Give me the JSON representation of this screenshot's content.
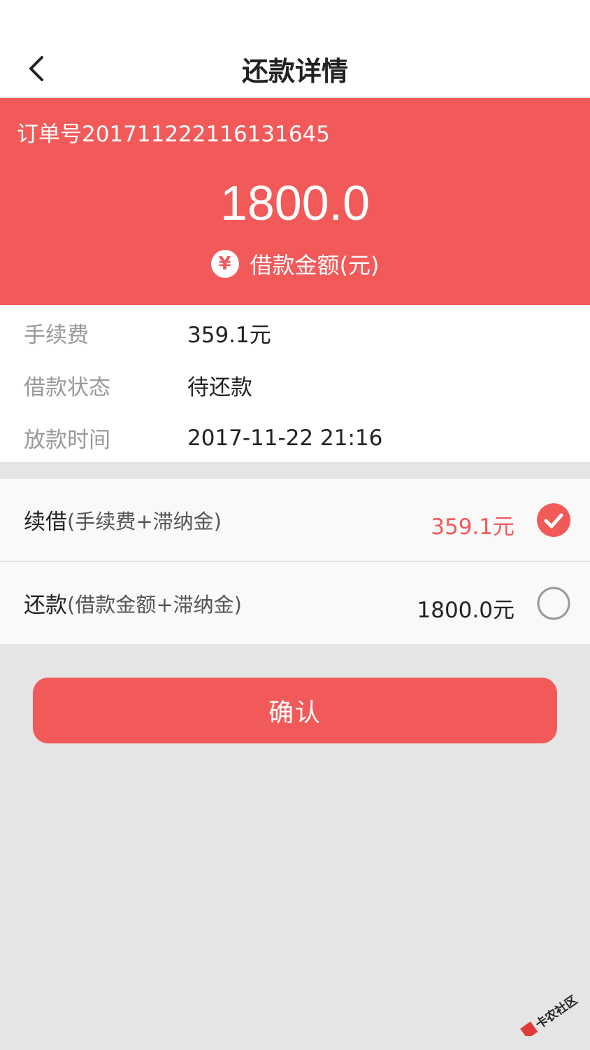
{
  "header": {
    "title": "还款详情"
  },
  "summary": {
    "order_no": "订单号20171122211613 1645",
    "amount": "1800.0",
    "amount_label": "借款金额(元)",
    "yen_symbol": "¥"
  },
  "details": [
    {
      "label": "手续费",
      "value": "359.1元"
    },
    {
      "label": "借款状态",
      "value": "待还款"
    },
    {
      "label": "放款时间",
      "value": "2017-11-22 21:16"
    }
  ],
  "options": [
    {
      "title": "续借",
      "subtitle": "(手续费+滞纳金)",
      "amount": "359.1元",
      "selected": true
    },
    {
      "title": "还款",
      "subtitle": "(借款金额+滞纳金)",
      "amount": "1800.0元",
      "selected": false
    }
  ],
  "confirm_label": "确认",
  "watermark_text": "卡农社区",
  "colors": {
    "accent": "#f25a5a",
    "radio_off": "#999999"
  },
  "icons": {
    "back": "chevron-left-icon",
    "currency": "yen-icon",
    "check": "check-circle-icon",
    "radio": "radio-empty-icon"
  }
}
